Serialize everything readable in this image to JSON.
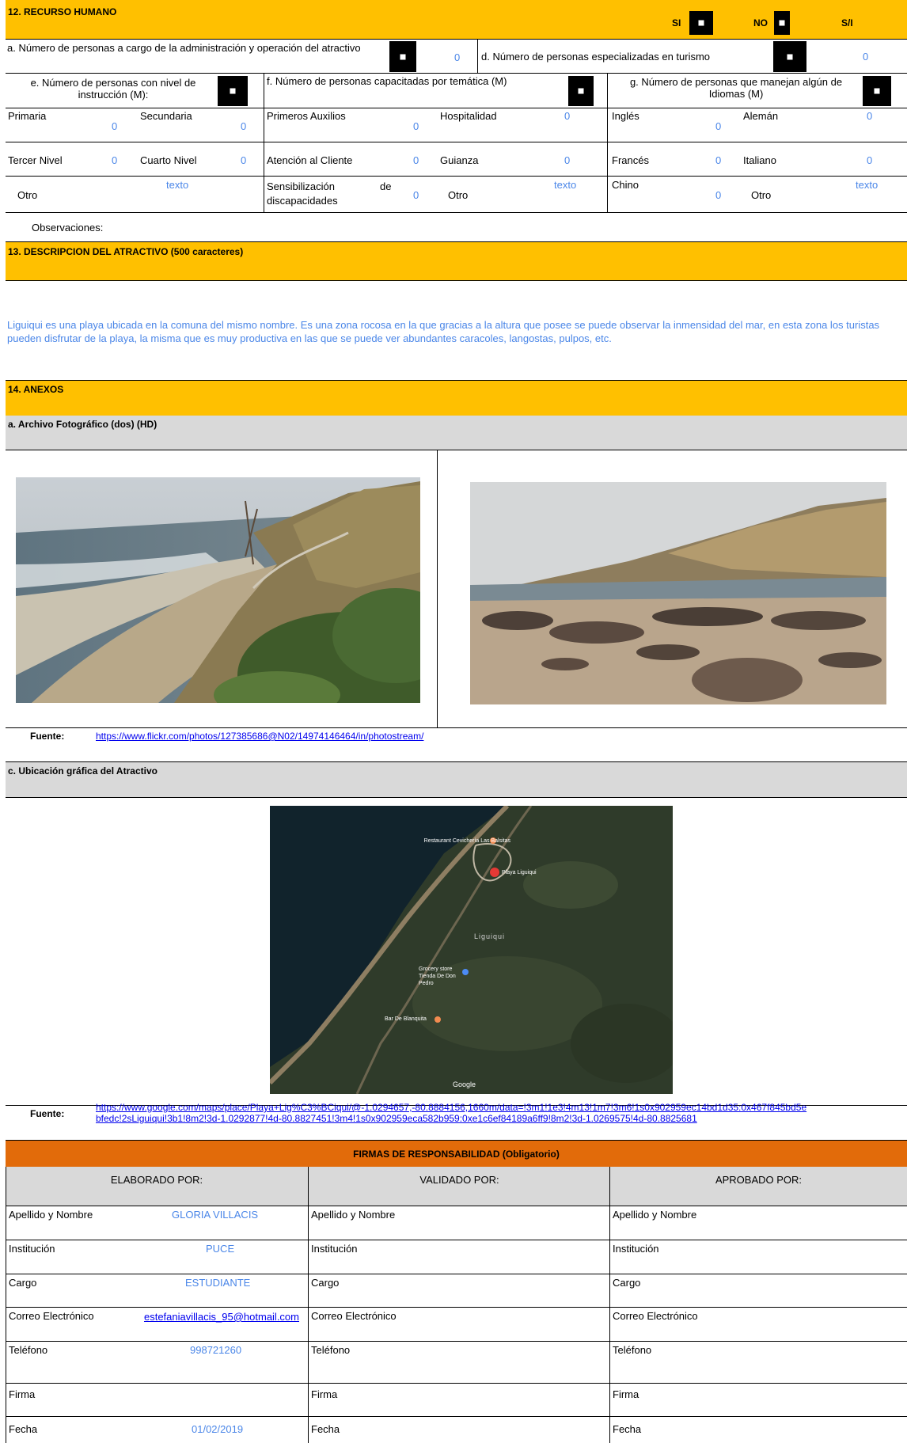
{
  "recurso": {
    "title": "12. RECURSO HUMANO",
    "si": "SI",
    "no": "NO",
    "si_label": "S/I",
    "a_label": "a. Número de personas a cargo de la administración y operación del atractivo",
    "a_value": "0",
    "d_label": "d. Número de personas especializadas en turismo",
    "d_value": "0",
    "e_label": "e. Número de personas con nivel de instrucción (M):",
    "f_label": "f. Número de personas capacitadas por temática (M)",
    "g_label": "g. Número de personas que manejan algún de Idiomas (M)",
    "primaria": "Primaria",
    "primaria_v": "0",
    "secundaria": "Secundaria",
    "secundaria_v": "0",
    "tercer": "Tercer Nivel",
    "tercer_v": "0",
    "cuarto": "Cuarto Nivel",
    "cuarto_v": "0",
    "otro_e": "Otro",
    "otro_e_v": "texto",
    "primeros": "Primeros Auxilios",
    "primeros_v": "0",
    "hospitalidad": "Hospitalidad",
    "hospitalidad_v": "0",
    "atencion": "Atención al Cliente",
    "atencion_v": "0",
    "guianza": "Guianza",
    "guianza_v": "0",
    "sensib1": "Sensibilización",
    "sensib_de": "de",
    "sensib2": "discapacidades",
    "sensib_v": "0",
    "otro_f": "Otro",
    "otro_f_v": "texto",
    "ingles": "Inglés",
    "ingles_v": "0",
    "aleman": "Alemán",
    "aleman_v": "0",
    "frances": "Francés",
    "frances_v": "0",
    "italiano": "Italiano",
    "italiano_v": "0",
    "chino": "Chino",
    "chino_v": "0",
    "otro_g": "Otro",
    "otro_g_v": "texto",
    "observaciones": "Observaciones:"
  },
  "descripcion": {
    "title": "13. DESCRIPCION DEL ATRACTIVO (500 caracteres)",
    "text": "Liguiqui es una playa ubicada en la comuna del mismo nombre. Es una zona rocosa en la que gracias a la altura que posee se puede observar la inmensidad del mar, en esta zona los turistas pueden disfrutar de la playa, la misma que es muy productiva en las que se puede ver abundantes caracoles, langostas, pulpos,  etc."
  },
  "anexos": {
    "title": "14. ANEXOS",
    "foto_title": "a. Archivo Fotográfico (dos) (HD)",
    "fuente_label": "Fuente:",
    "fuente_foto": "https://www.flickr.com/photos/127385686@N02/14974146464/in/photostream/",
    "ubicacion_title": "c. Ubicación gráfica del Atractivo",
    "fuente_mapa": "https://www.google.com/maps/place/Playa+Lig%C3%BCiqui/@-1.0294657,-80.8884156,1660m/data=!3m1!1e3!4m13!1m7!3m6!1s0x902959ec14bd1d35:0x467f845bd5ebfedc!2sLiguiqui!3b1!8m2!3d-1.0292877!4d-80.8827451!3m4!1s0x902959eca582b959:0xe1c6ef84189a6ff9!8m2!3d-1.0269575!4d-80.8825681",
    "map_labels": {
      "restaurant": "Restaurant Cevichería Las Balsitas",
      "playa": "Playa Liguiqui",
      "liguiqui": "Liguiqui",
      "grocery": "Grocery store Tienda De Don Pedro",
      "bar": "Bar De Blanquita",
      "google": "Google"
    }
  },
  "firmas": {
    "title": "FIRMAS DE RESPONSABILIDAD (Obligatorio)",
    "elaborado": "ELABORADO POR:",
    "validado": "VALIDADO  POR:",
    "aprobado": "APROBADO POR:",
    "apellido": "Apellido y Nombre",
    "institucion": "Institución",
    "cargo": "Cargo",
    "correo": "Correo Electrónico",
    "telefono": "Teléfono",
    "firma": "Firma",
    "fecha": "Fecha",
    "v_apellido": "GLORIA VILLACIS",
    "v_institucion": "PUCE",
    "v_cargo": "ESTUDIANTE",
    "v_correo": "estefaniavillacis_95@hotmail.com",
    "v_telefono": "998721260",
    "v_fecha": "01/02/2019"
  },
  "colors": {
    "yellow": "#ffc000",
    "orange": "#e26b0a",
    "gray": "#d9d9d9",
    "value_blue": "#4a86e8"
  }
}
